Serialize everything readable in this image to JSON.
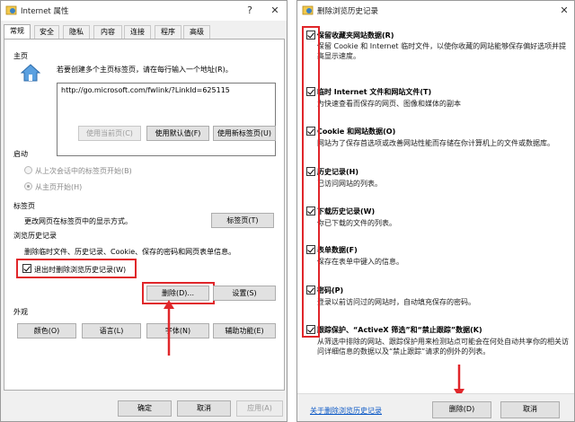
{
  "left_window": {
    "title": "Internet 属性",
    "tabs": [
      "常规",
      "安全",
      "隐私",
      "内容",
      "连接",
      "程序",
      "高级"
    ],
    "home": {
      "section": "主页",
      "desc": "若要创建多个主页标签页，请在每行输入一个地址(R)。",
      "url": "http://go.microsoft.com/fwlink/?LinkId=625115",
      "btn_current": "使用当前页(C)",
      "btn_default": "使用默认值(F)",
      "btn_newtab": "使用新标签页(U)"
    },
    "startup": {
      "section": "启动",
      "opt1": "从上次会话中的标签页开始(B)",
      "opt2": "从主页开始(H)"
    },
    "tabs_section": {
      "section": "标签页",
      "desc": "更改网页在标签页中的显示方式。",
      "btn": "标签页(T)"
    },
    "history": {
      "section": "浏览历史记录",
      "desc": "删除临时文件、历史记录、Cookie、保存的密码和网页表单信息。",
      "checkbox": "退出时删除浏览历史记录(W)",
      "btn_delete": "删除(D)...",
      "btn_settings": "设置(S)"
    },
    "appearance": {
      "section": "外观",
      "btn_colors": "颜色(O)",
      "btn_lang": "语言(L)",
      "btn_fonts": "字体(N)",
      "btn_access": "辅助功能(E)"
    },
    "footer": {
      "ok": "确定",
      "cancel": "取消",
      "apply": "应用(A)"
    }
  },
  "right_window": {
    "title": "删除浏览历史记录",
    "items": [
      {
        "title": "保留收藏夹网站数据(R)",
        "desc": "保留 Cookie 和 Internet 临时文件，以使你收藏的网站能够保存偏好选项并提高显示速度。",
        "checked": true
      },
      {
        "title": "临时 Internet 文件和网站文件(T)",
        "desc": "为快速查看而保存的网页、图像和媒体的副本",
        "checked": true
      },
      {
        "title": "Cookie 和网站数据(O)",
        "desc": "网站为了保存首选项或改善网站性能而存储在你计算机上的文件或数据库。",
        "checked": true
      },
      {
        "title": "历史记录(H)",
        "desc": "已访问网站的列表。",
        "checked": true
      },
      {
        "title": "下载历史记录(W)",
        "desc": "你已下载的文件的列表。",
        "checked": true
      },
      {
        "title": "表单数据(F)",
        "desc": "保存在表单中键入的信息。",
        "checked": true
      },
      {
        "title": "密码(P)",
        "desc": "登录以前访问过的网站时，自动填充保存的密码。",
        "checked": true
      },
      {
        "title": "跟踪保护、“ActiveX 筛选”和“禁止跟踪”数据(K)",
        "desc": "从筛选中排除的网站、跟踪保护用来检测站点可能会在何处自动共享你的相关访问详细信息的数据以及“禁止跟踪”请求的例外的列表。",
        "checked": true
      }
    ],
    "link": "关于删除浏览历史记录",
    "btn_delete": "删除(D)",
    "btn_cancel": "取消"
  },
  "colors": {
    "highlight_red": "#e0262a",
    "link_blue": "#0b58c6"
  }
}
